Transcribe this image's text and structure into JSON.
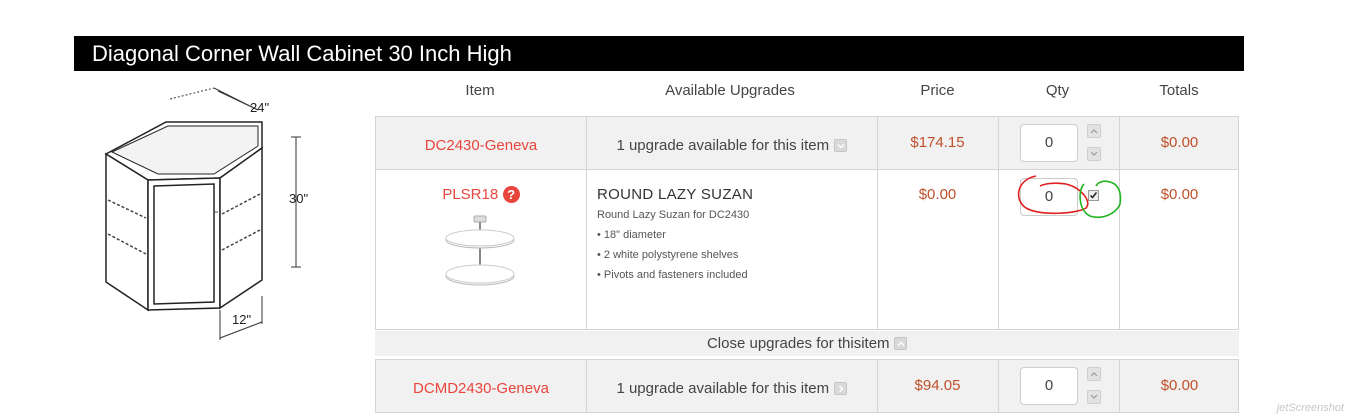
{
  "title": "Diagonal Corner Wall Cabinet 30 Inch High",
  "dimensions": {
    "width_label": "24\"",
    "height_label": "30\"",
    "depth_label": "12\""
  },
  "columns": {
    "item": "Item",
    "upgrades": "Available Upgrades",
    "price": "Price",
    "qty": "Qty",
    "totals": "Totals"
  },
  "rows": [
    {
      "item": "DC2430-Geneva",
      "upgrade_text": "1 upgrade available for this item",
      "price": "$174.15",
      "qty": "0",
      "total": "$0.00"
    },
    {
      "item": "DCMD2430-Geneva",
      "upgrade_text": "1 upgrade available for this item",
      "price": "$94.05",
      "qty": "0",
      "total": "$0.00"
    }
  ],
  "upgrade": {
    "item": "PLSR18",
    "help_glyph": "?",
    "name": "ROUND LAZY SUZAN",
    "subtitle": "Round Lazy Suzan for DC2430",
    "bullets": [
      "• 18\" diameter",
      "• 2 white polystyrene shelves",
      "• Pivots and fasteners included"
    ],
    "price": "$0.00",
    "qty": "0",
    "checked": true,
    "total": "$0.00"
  },
  "close_upgrades": "Close upgrades for thisitem",
  "watermark": "jetScreenshot",
  "colors": {
    "accent_red": "#e8453c",
    "price_color": "#c0502a",
    "annotation_red": "#e02020",
    "annotation_green": "#22b422"
  },
  "icons": {
    "expand": "chevron-down-icon",
    "collapse": "chevron-up-icon",
    "help": "question-icon",
    "expand_right": "chevron-right-icon"
  }
}
